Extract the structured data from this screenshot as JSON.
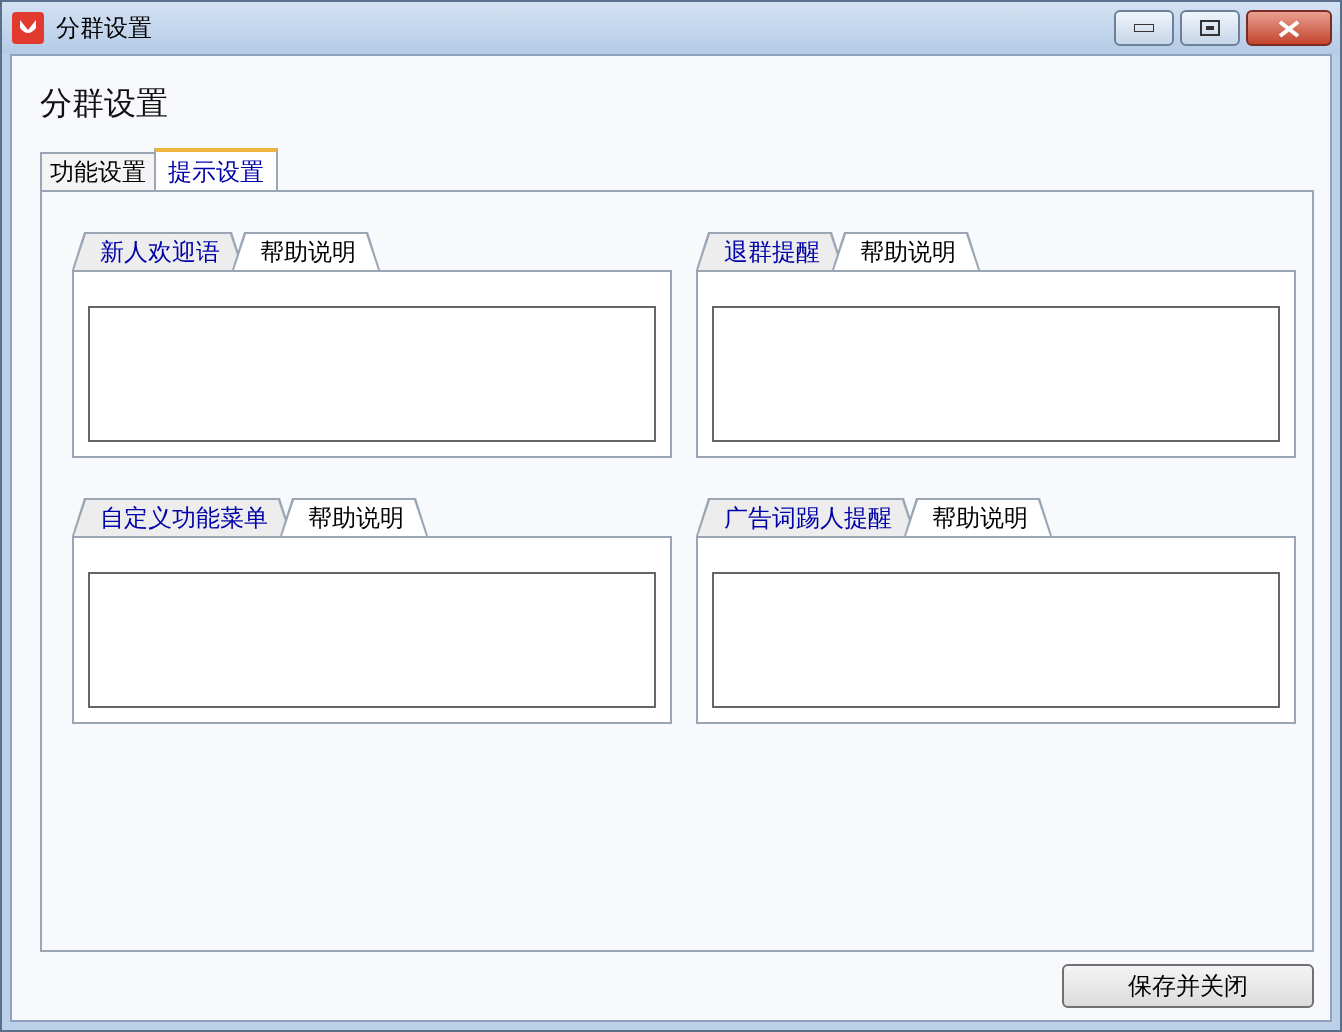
{
  "window": {
    "title": "分群设置"
  },
  "heading": "分群设置",
  "tabs": [
    {
      "label": "功能设置",
      "selected": false
    },
    {
      "label": "提示设置",
      "selected": true
    }
  ],
  "panels": [
    {
      "tabs": [
        {
          "label": "新人欢迎语",
          "selected": true
        },
        {
          "label": "帮助说明",
          "selected": false
        }
      ]
    },
    {
      "tabs": [
        {
          "label": "退群提醒",
          "selected": true
        },
        {
          "label": "帮助说明",
          "selected": false
        }
      ]
    },
    {
      "tabs": [
        {
          "label": "自定义功能菜单",
          "selected": true
        },
        {
          "label": "帮助说明",
          "selected": false
        }
      ]
    },
    {
      "tabs": [
        {
          "label": "广告词踢人提醒",
          "selected": true
        },
        {
          "label": "帮助说明",
          "selected": false
        }
      ]
    }
  ],
  "buttons": [
    "保存并关闭"
  ]
}
